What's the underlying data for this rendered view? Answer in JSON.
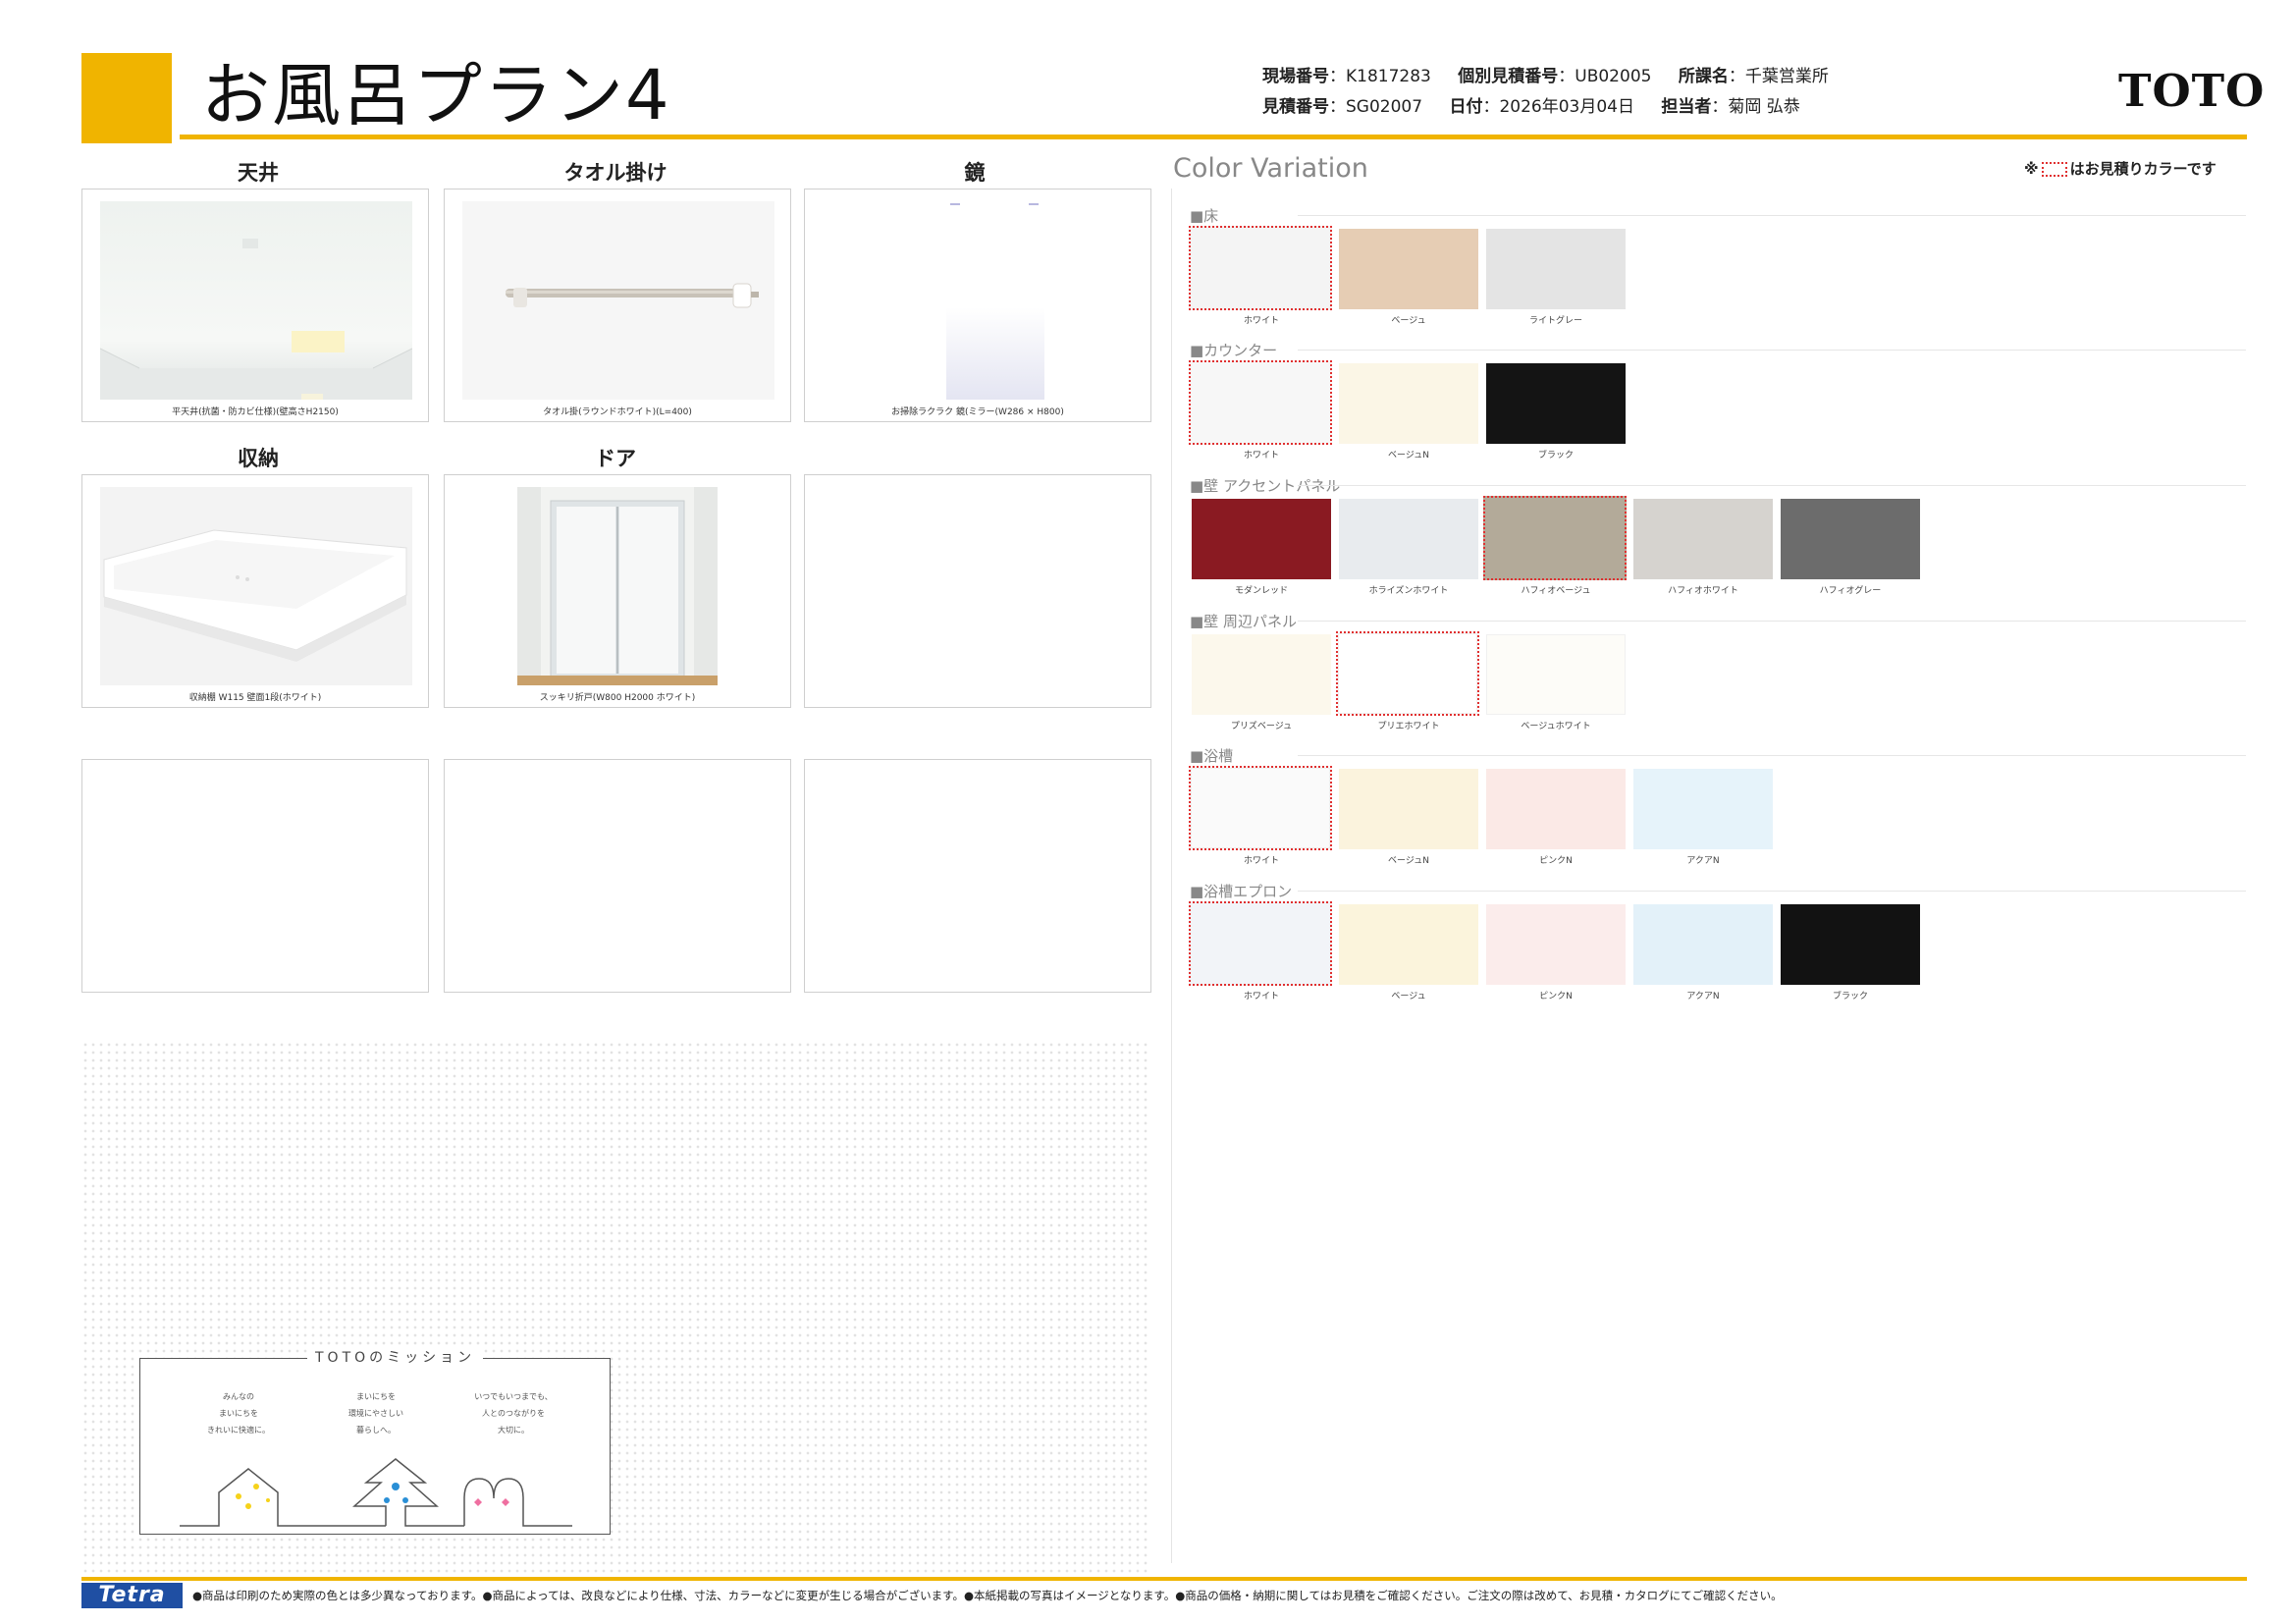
{
  "header": {
    "title": "お風呂プラン4",
    "brand": "TOTO",
    "site_no_label": "現場番号",
    "site_no": "：K1817283",
    "estimate_indiv_label": "個別見積番号",
    "estimate_indiv": "：UB02005",
    "office_label": "所課名",
    "office": "：千葉営業所",
    "estimate_no_label": "見積番号",
    "estimate_no": "：SG02007",
    "date_label": "日付",
    "date": "：2026年03月04日",
    "person_label": "担当者",
    "person": "：菊岡 弘恭"
  },
  "products": [
    {
      "label": "天井",
      "caption": "平天井(抗菌・防カビ仕様)(壁高さH2150)"
    },
    {
      "label": "タオル掛け",
      "caption": "タオル掛(ラウンドホワイト)(L=400)"
    },
    {
      "label": "鏡",
      "caption": "お掃除ラクラク 鏡(ミラー(W286 × H800)"
    },
    {
      "label": "収納",
      "caption": "収納棚 W115 壁面1段(ホワイト)"
    },
    {
      "label": "ドア",
      "caption": "スッキリ折戸(W800 H2000 ホワイト)"
    }
  ],
  "mission": {
    "title": "TOTOのミッション",
    "col1": "みんなの\nまいにちを\nきれいに快適に。",
    "col2": "まいにちを\n環境にやさしい\n暮らしへ。",
    "col3": "いつでもいつまでも、\n人とのつながりを\n大切に。"
  },
  "color_variation": {
    "title": "Color Variation",
    "note_prefix": "※",
    "note_suffix": "はお見積りカラーです",
    "sections": [
      {
        "name": "■床",
        "swatches": [
          {
            "label": "ホワイト",
            "color": "#f4f4f4",
            "selected": true
          },
          {
            "label": "ベージュ",
            "color": "#e6cdb4",
            "selected": false
          },
          {
            "label": "ライトグレー",
            "color": "#e4e4e4",
            "selected": false
          }
        ]
      },
      {
        "name": "■カウンター",
        "swatches": [
          {
            "label": "ホワイト",
            "color": "#f7f7f7",
            "selected": true
          },
          {
            "label": "ベージュN",
            "color": "#fbf6e6",
            "selected": false
          },
          {
            "label": "ブラック",
            "color": "#141414",
            "selected": false
          }
        ]
      },
      {
        "name": "■壁 アクセントパネル",
        "swatches": [
          {
            "label": "モダンレッド",
            "color": "#8a1a22",
            "selected": false
          },
          {
            "label": "ホライズンホワイト",
            "color": "#e8ebee",
            "selected": false
          },
          {
            "label": "ハフィオベージュ",
            "color": "#b3aa99",
            "selected": true
          },
          {
            "label": "ハフィオホワイト",
            "color": "#d6d3cf",
            "selected": false
          },
          {
            "label": "ハフィオグレー",
            "color": "#6c6c6c",
            "selected": false
          }
        ]
      },
      {
        "name": "■壁 周辺パネル",
        "swatches": [
          {
            "label": "プリズベージュ",
            "color": "#fcf8ec",
            "selected": false
          },
          {
            "label": "プリエホワイト",
            "color": "#ffffff",
            "selected": true
          },
          {
            "label": "ベージュホワイト",
            "color": "#fdfcf8",
            "selected": false
          }
        ]
      },
      {
        "name": "■浴槽",
        "swatches": [
          {
            "label": "ホワイト",
            "color": "#fafafa",
            "selected": true
          },
          {
            "label": "ベージュN",
            "color": "#fbf3dd",
            "selected": false
          },
          {
            "label": "ピンクN",
            "color": "#fbe9e6",
            "selected": false
          },
          {
            "label": "アクアN",
            "color": "#e6f3fa",
            "selected": false
          }
        ]
      },
      {
        "name": "■浴槽エプロン",
        "swatches": [
          {
            "label": "ホワイト",
            "color": "#f2f4f8",
            "selected": true
          },
          {
            "label": "ベージュ",
            "color": "#fbf4dc",
            "selected": false
          },
          {
            "label": "ピンクN",
            "color": "#fbeceb",
            "selected": false
          },
          {
            "label": "アクアN",
            "color": "#e3f1f9",
            "selected": false
          },
          {
            "label": "ブラック",
            "color": "#121212",
            "selected": false
          }
        ]
      }
    ]
  },
  "footer": {
    "logo": "Tetra",
    "text": "●商品は印刷のため実際の色とは多少異なっております。●商品によっては、改良などにより仕様、寸法、カラーなどに変更が生じる場合がございます。●本紙掲載の写真はイメージとなります。●商品の価格・納期に関してはお見積をご確認ください。ご注文の際は改めて、お見積・カタログにてご確認ください。"
  },
  "colors": {
    "accent": "#f0b400",
    "selected_outline": "#e03030",
    "tetra_blue": "#1f4fa3"
  }
}
